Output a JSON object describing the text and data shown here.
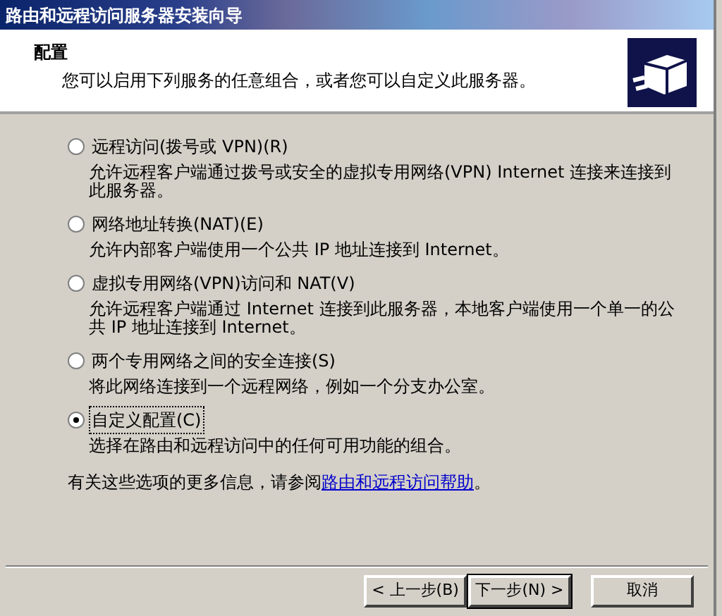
{
  "window": {
    "title": "路由和远程访问服务器安装向导"
  },
  "header": {
    "title": "配置",
    "subtitle": "您可以启用下列服务的任意组合，或者您可以自定义此服务器。"
  },
  "options": [
    {
      "label": "远程访问(拨号或 VPN)(R)",
      "description": "允许远程客户端通过拨号或安全的虚拟专用网络(VPN) Internet 连接来连接到此服务器。",
      "selected": false
    },
    {
      "label": "网络地址转换(NAT)(E)",
      "description": "允许内部客户端使用一个公共 IP 地址连接到 Internet。",
      "selected": false
    },
    {
      "label": "虚拟专用网络(VPN)访问和 NAT(V)",
      "description": "允许远程客户端通过 Internet 连接到此服务器，本地客户端使用一个单一的公共 IP 地址连接到 Internet。",
      "selected": false
    },
    {
      "label": "两个专用网络之间的安全连接(S)",
      "description": "将此网络连接到一个远程网络，例如一个分支办公室。",
      "selected": false
    },
    {
      "label": "自定义配置(C)",
      "description": "选择在路由和远程访问中的任何可用功能的组合。",
      "selected": true
    }
  ],
  "help": {
    "text": "有关这些选项的更多信息，请参阅",
    "link": "路由和远程访问帮助",
    "end": "。"
  },
  "buttons": [
    {
      "label": "< 上一步(B)",
      "default": false
    },
    {
      "label": "下一步(N) >",
      "default": true
    },
    {
      "label": "取消",
      "default": false
    }
  ]
}
